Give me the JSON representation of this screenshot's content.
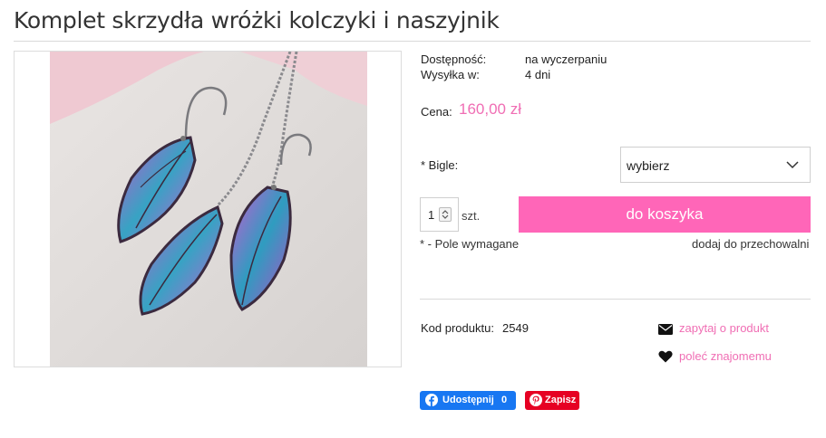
{
  "product": {
    "title": "Komplet skrzydła wróżki kolczyki i naszyjnik",
    "image_alt": "Kolczyki i naszyjnik w kształcie skrzydeł wróżki"
  },
  "details": {
    "availability_label": "Dostępność:",
    "availability_value": "na wyczerpaniu",
    "shipping_label": "Wysyłka w:",
    "shipping_value": "4 dni",
    "price_label": "Cena:",
    "price_value": "160,00 zł"
  },
  "options": {
    "bigle_label": "* Bigle:",
    "bigle_selected": "wybierz"
  },
  "cart": {
    "quantity": "1",
    "unit": "szt.",
    "button_label": "do koszyka",
    "required_note": "* - Pole wymagane",
    "storage_link": "dodaj do przechowalni"
  },
  "meta": {
    "code_label": "Kod produktu:",
    "code_value": "2549",
    "ask_link": "zapytaj o produkt",
    "recommend_link": "poleć znajomemu"
  },
  "share": {
    "facebook_label": "Udostępnij",
    "facebook_count": "0",
    "pinterest_label": "Zapisz"
  },
  "colors": {
    "accent": "#ff66b8",
    "price": "#f06eb4",
    "facebook": "#1877f2",
    "pinterest": "#e60023"
  }
}
